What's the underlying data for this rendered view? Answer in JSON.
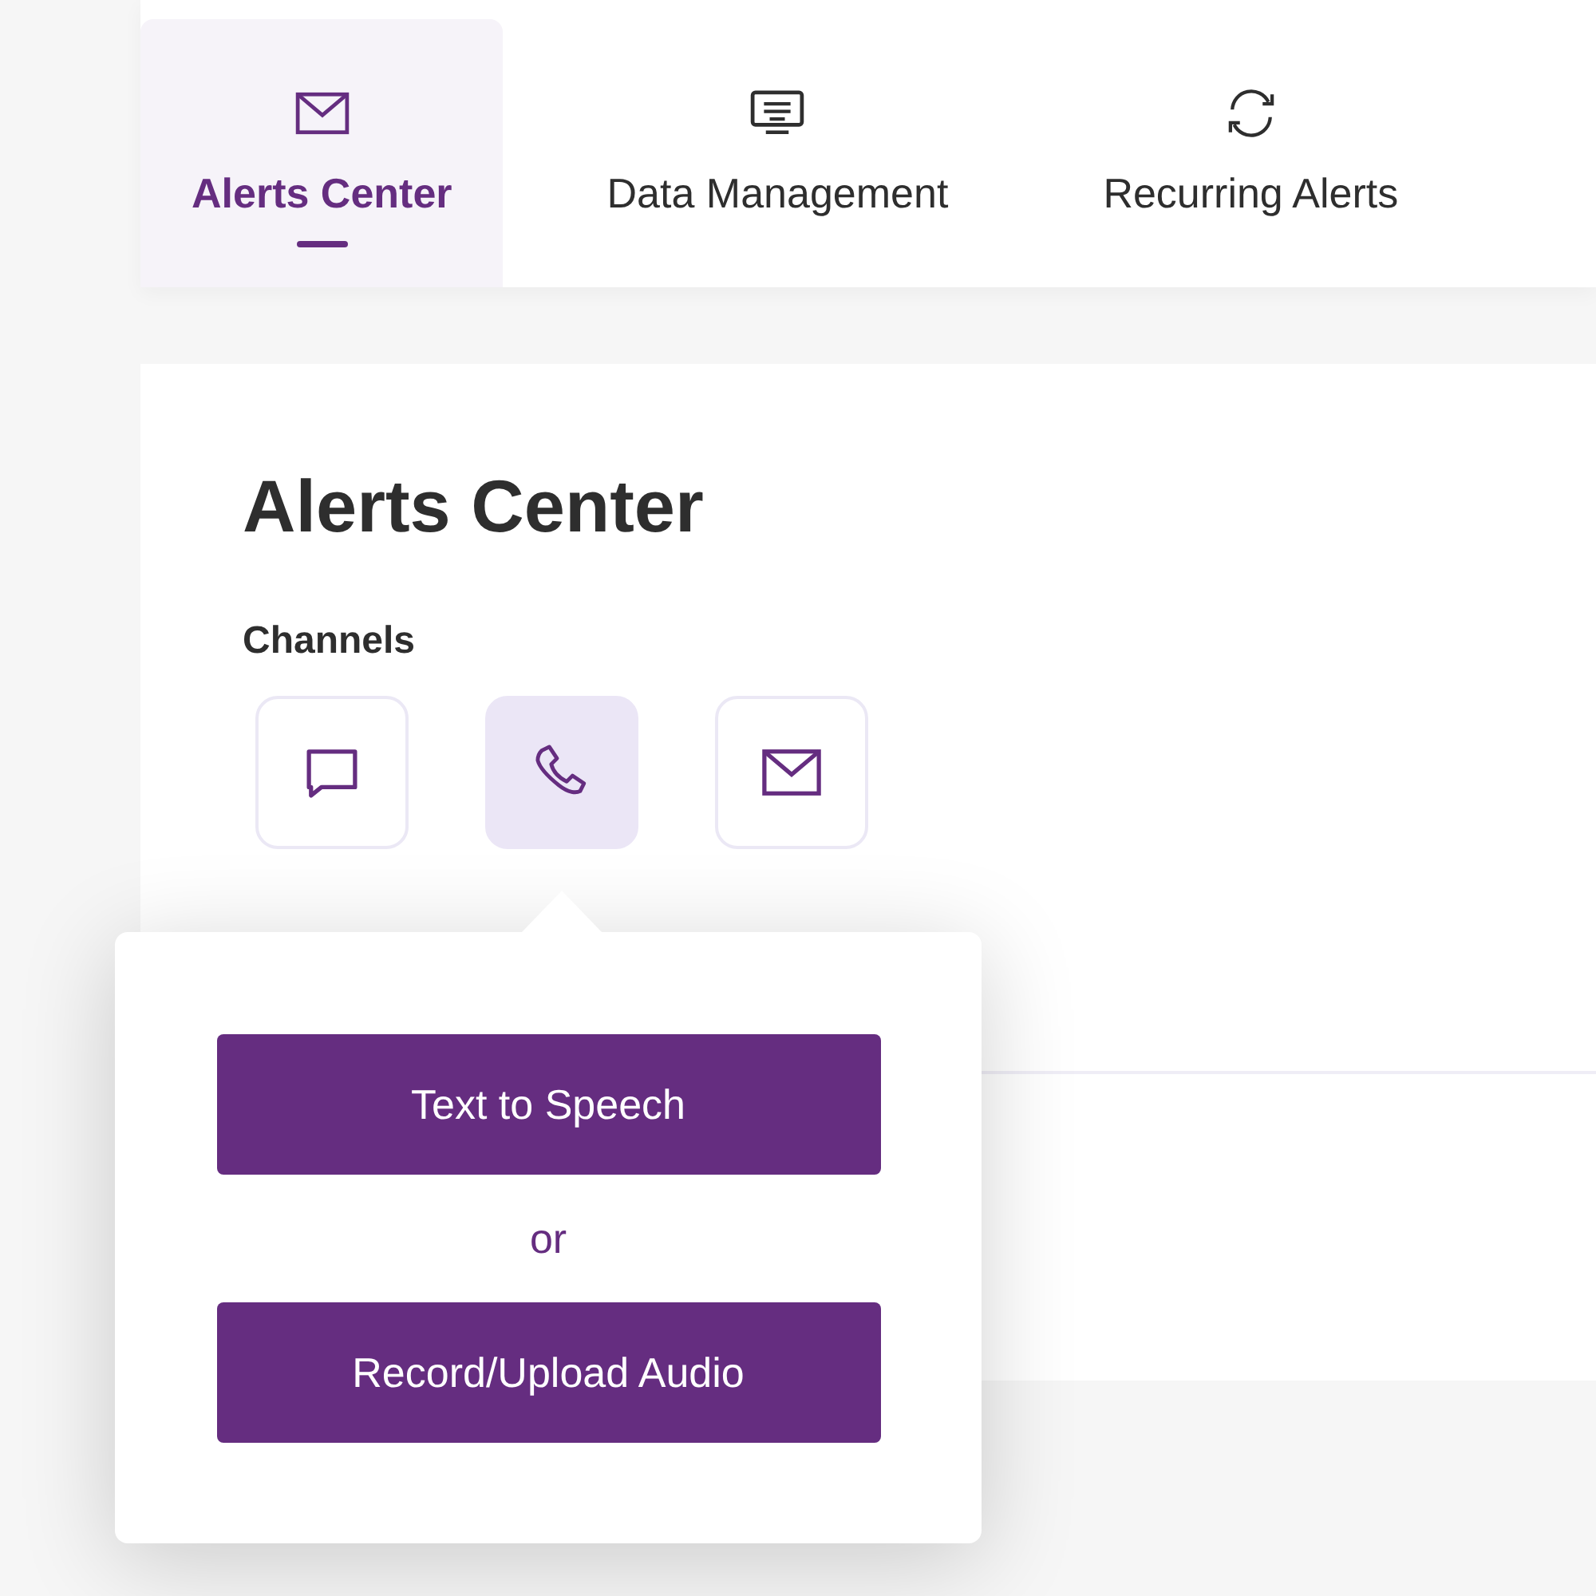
{
  "tabs": [
    {
      "label": "Alerts Center",
      "kind": "envelope",
      "selected": true
    },
    {
      "label": "Data Management",
      "kind": "monitor",
      "selected": false
    },
    {
      "label": "Recurring Alerts",
      "kind": "sync",
      "selected": false
    }
  ],
  "page": {
    "title": "Alerts Center",
    "section": "Channels"
  },
  "channels": [
    {
      "kind": "chat",
      "selected": false
    },
    {
      "kind": "phone",
      "selected": true
    },
    {
      "kind": "envelope",
      "selected": false
    }
  ],
  "popover": {
    "buttons": [
      "Text to Speech",
      "Record/Upload Audio"
    ],
    "separator": "or"
  }
}
